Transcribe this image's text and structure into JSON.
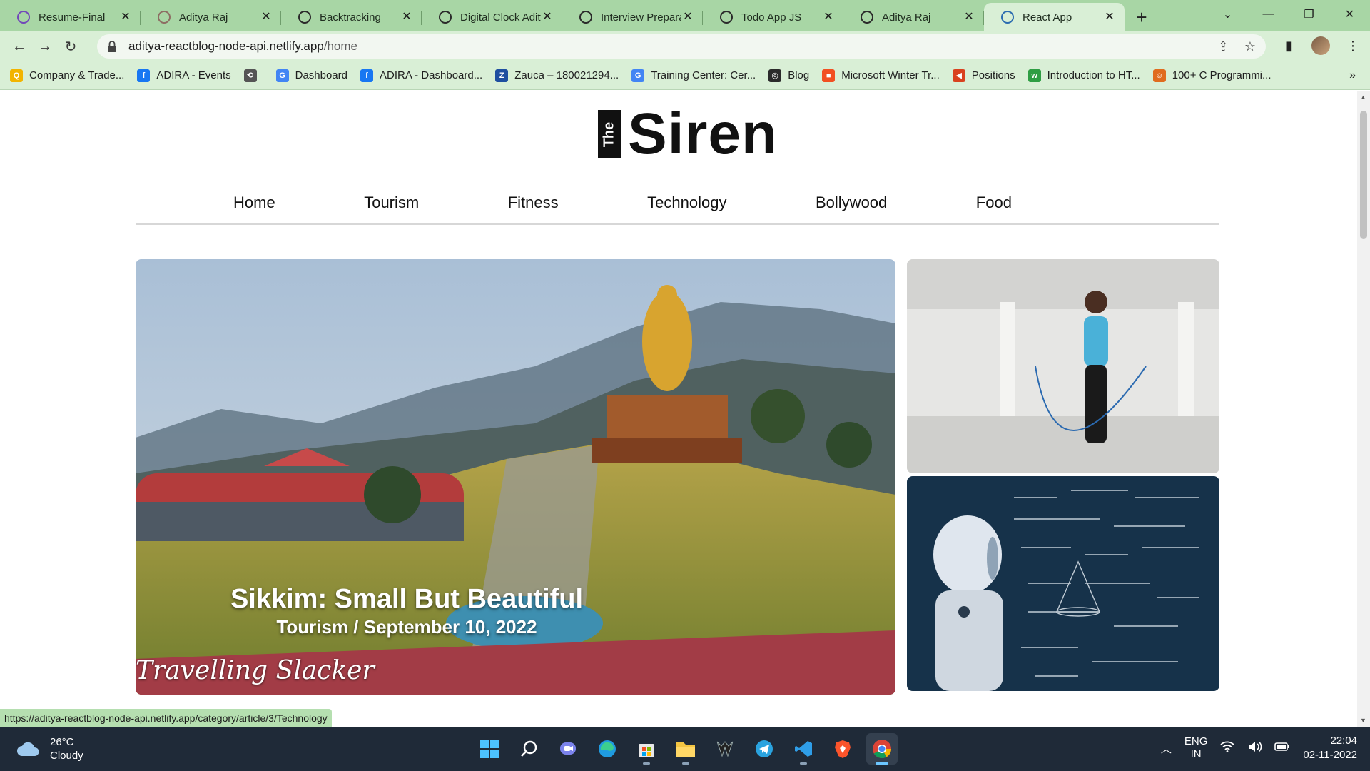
{
  "browser": {
    "tabs": [
      {
        "title": "Resume-Final",
        "favicon": "forms-icon",
        "color": "#7248b9",
        "active": false
      },
      {
        "title": "Aditya Raj",
        "favicon": "profile-icon",
        "color": "#8d6e63",
        "active": false
      },
      {
        "title": "Backtracking",
        "favicon": "globe-icon",
        "color": "#2b2b2b",
        "active": false
      },
      {
        "title": "Digital Clock Aditya",
        "favicon": "globe-icon",
        "color": "#2b2b2b",
        "active": false
      },
      {
        "title": "Interview Preparation",
        "favicon": "globe-icon",
        "color": "#2b2b2b",
        "active": false
      },
      {
        "title": "Todo App JS",
        "favicon": "globe-icon",
        "color": "#2b2b2b",
        "active": false
      },
      {
        "title": "Aditya Raj",
        "favicon": "globe-icon",
        "color": "#2b2b2b",
        "active": false
      },
      {
        "title": "React App",
        "favicon": "react-icon",
        "color": "#2b6cb0",
        "active": true
      }
    ],
    "new_tab_label": "+",
    "url_host": "aditya-reactblog-node-api.netlify.app",
    "url_path": "/home",
    "bookmarks": [
      {
        "label": "Company & Trade...",
        "icon": "q-icon",
        "color": "#f2b400",
        "glyph": "Q"
      },
      {
        "label": "ADIRA - Events",
        "icon": "facebook-icon",
        "color": "#1877f2",
        "glyph": "f"
      },
      {
        "label": "",
        "icon": "history-icon",
        "color": "#555555",
        "glyph": "⟲"
      },
      {
        "label": "Dashboard",
        "icon": "google-icon",
        "color": "#4285f4",
        "glyph": "G"
      },
      {
        "label": "ADIRA - Dashboard...",
        "icon": "facebook-icon",
        "color": "#1877f2",
        "glyph": "f"
      },
      {
        "label": "Zauca – 180021294...",
        "icon": "z-icon",
        "color": "#1f4fa0",
        "glyph": "Z"
      },
      {
        "label": "Training Center: Cer...",
        "icon": "google-icon",
        "color": "#4285f4",
        "glyph": "G"
      },
      {
        "label": "Blog",
        "icon": "globe-icon",
        "color": "#2b2b2b",
        "glyph": "◎"
      },
      {
        "label": "Microsoft Winter Tr...",
        "icon": "microsoft-icon",
        "color": "#f25022",
        "glyph": "■"
      },
      {
        "label": "Positions",
        "icon": "red-arrow-icon",
        "color": "#d9411e",
        "glyph": "◀"
      },
      {
        "label": "Introduction to HT...",
        "icon": "w3-icon",
        "color": "#2f9e44",
        "glyph": "w"
      },
      {
        "label": "100+ C Programmi...",
        "icon": "tutorial-icon",
        "color": "#e06c1f",
        "glyph": "☺"
      }
    ],
    "bookmarks_more": "»",
    "status_url": "https://aditya-reactblog-node-api.netlify.app/category/article/3/Technology"
  },
  "site": {
    "logo_the": "The",
    "logo_name": "Siren",
    "nav": [
      "Home",
      "Tourism",
      "Fitness",
      "Technology",
      "Bollywood",
      "Food"
    ]
  },
  "hero": {
    "title": "Sikkim: Small But Beautiful",
    "meta": "Tourism / September 10, 2022",
    "watermark": "Travelling Slacker"
  },
  "taskbar": {
    "temperature": "26°C",
    "condition": "Cloudy",
    "lang_top": "ENG",
    "lang_bottom": "IN",
    "time": "22:04",
    "date": "02-11-2022"
  }
}
